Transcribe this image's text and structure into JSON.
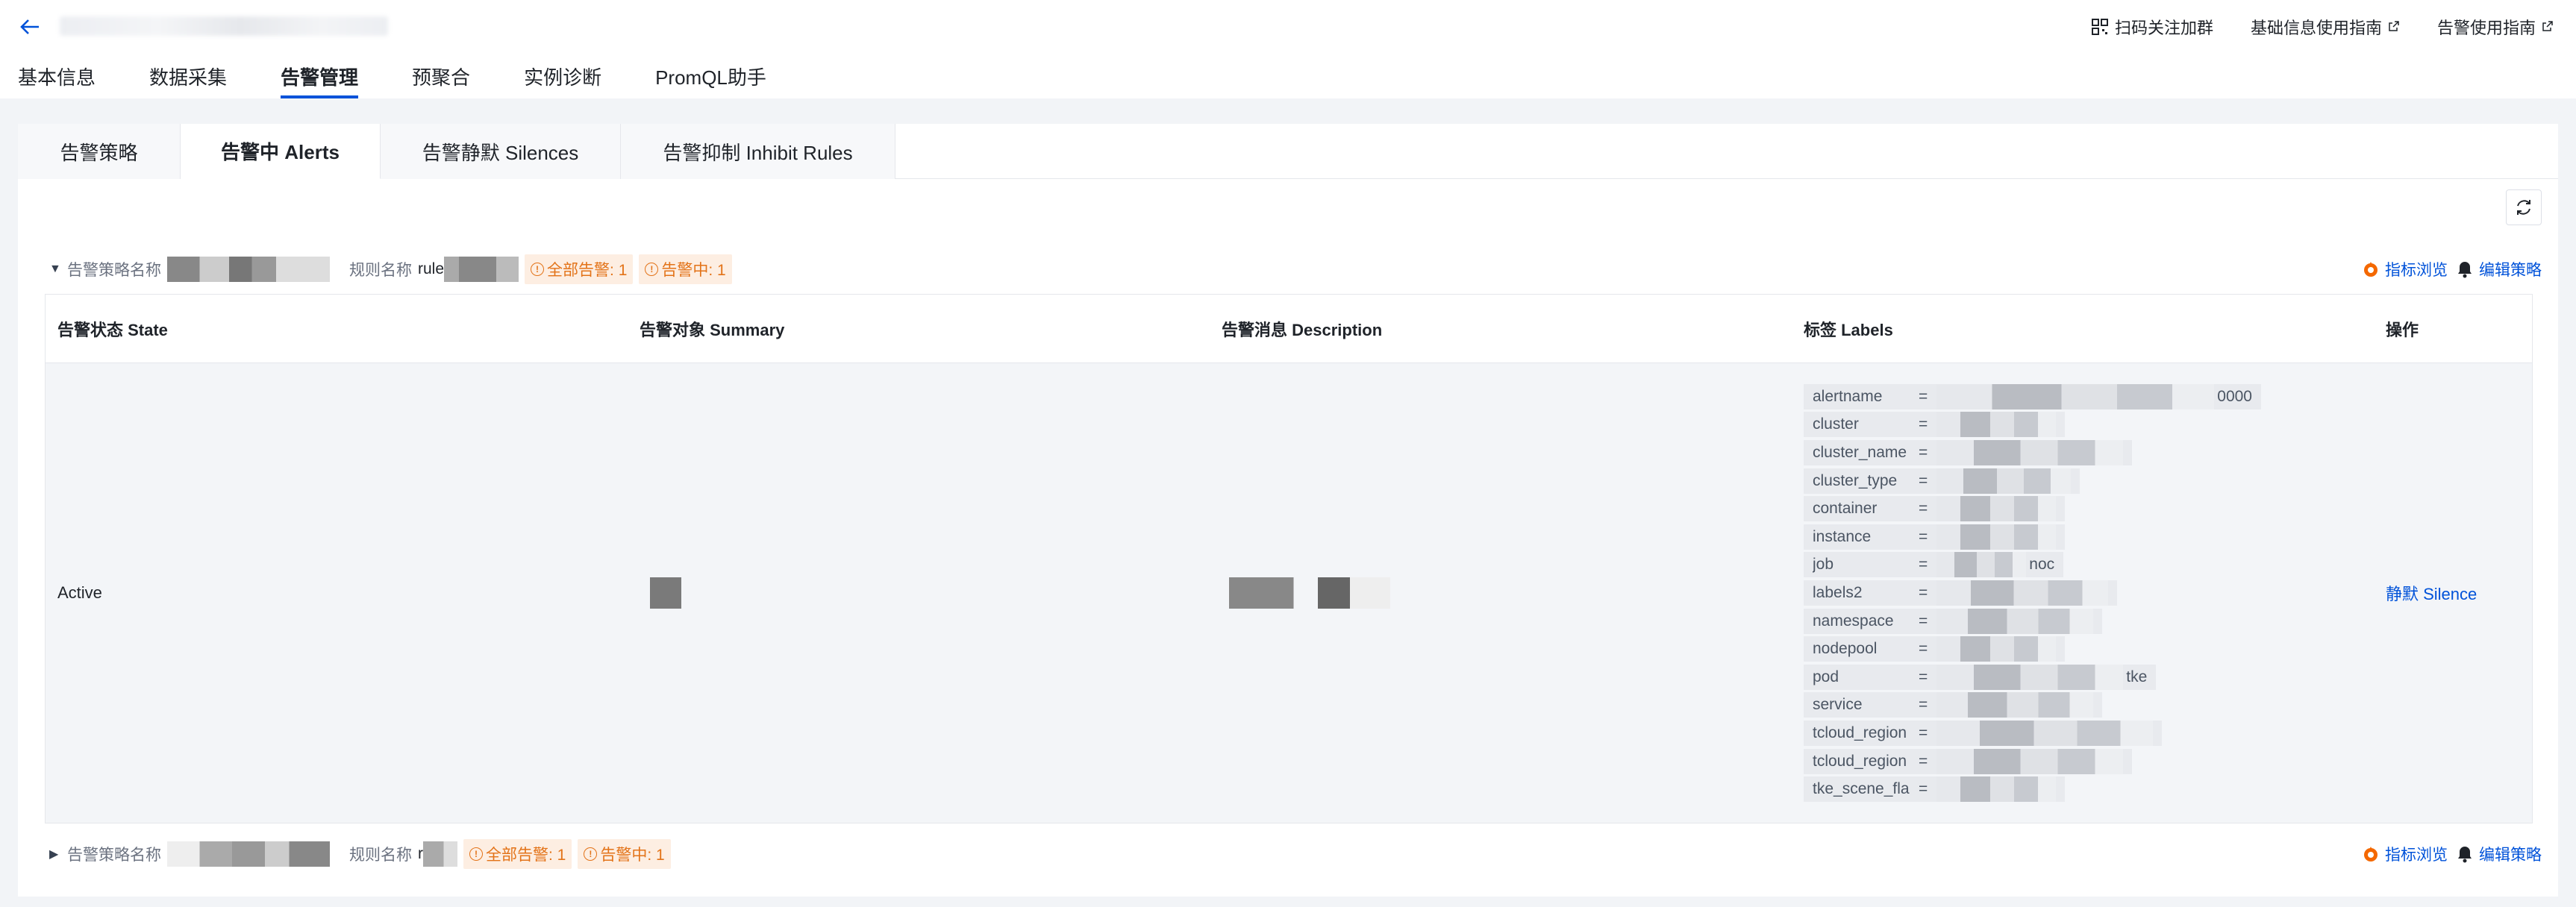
{
  "topbar": {
    "links": [
      {
        "label": "扫码关注加群",
        "icon": "qrcode-icon"
      },
      {
        "label": "基础信息使用指南",
        "icon": "external-link-icon"
      },
      {
        "label": "告警使用指南",
        "icon": "external-link-icon"
      }
    ]
  },
  "main_tabs": [
    "基本信息",
    "数据采集",
    "告警管理",
    "预聚合",
    "实例诊断",
    "PromQL助手"
  ],
  "main_tab_active": "告警管理",
  "sub_tabs": [
    "告警策略",
    "告警中 Alerts",
    "告警静默 Silences",
    "告警抑制 Inhibit Rules"
  ],
  "sub_tab_active": "告警中 Alerts",
  "groups": [
    {
      "policy_label": "告警策略名称",
      "rule_label": "规则名称",
      "rule_value_prefix": "rule",
      "tag_all": "全部告警: 1",
      "tag_firing": "告警中: 1",
      "action_metrics": "指标浏览",
      "action_edit": "编辑策略"
    },
    {
      "policy_label": "告警策略名称",
      "rule_label": "规则名称",
      "rule_value_prefix": "r",
      "tag_all": "全部告警: 1",
      "tag_firing": "告警中: 1",
      "action_metrics": "指标浏览",
      "action_edit": "编辑策略"
    }
  ],
  "table": {
    "headers": [
      "告警状态 State",
      "告警对象 Summary",
      "告警消息 Description",
      "标签 Labels",
      "操作"
    ],
    "row": {
      "state": "Active",
      "action": "静默 Silence",
      "labels": [
        {
          "key": "alertname",
          "suffix": "0000"
        },
        {
          "key": "cluster"
        },
        {
          "key": "cluster_name"
        },
        {
          "key": "cluster_type"
        },
        {
          "key": "container"
        },
        {
          "key": "instance"
        },
        {
          "key": "job",
          "suffix": "noc"
        },
        {
          "key": "labels2"
        },
        {
          "key": "namespace"
        },
        {
          "key": "nodepool"
        },
        {
          "key": "pod",
          "suffix": "tke"
        },
        {
          "key": "service"
        },
        {
          "key": "tcloud_region"
        },
        {
          "key": "tcloud_region"
        },
        {
          "key": "tke_scene_fla"
        }
      ]
    }
  },
  "colors": {
    "primary": "#0052d9",
    "warning": "#e37318",
    "warning_bg": "#fdeee2"
  }
}
